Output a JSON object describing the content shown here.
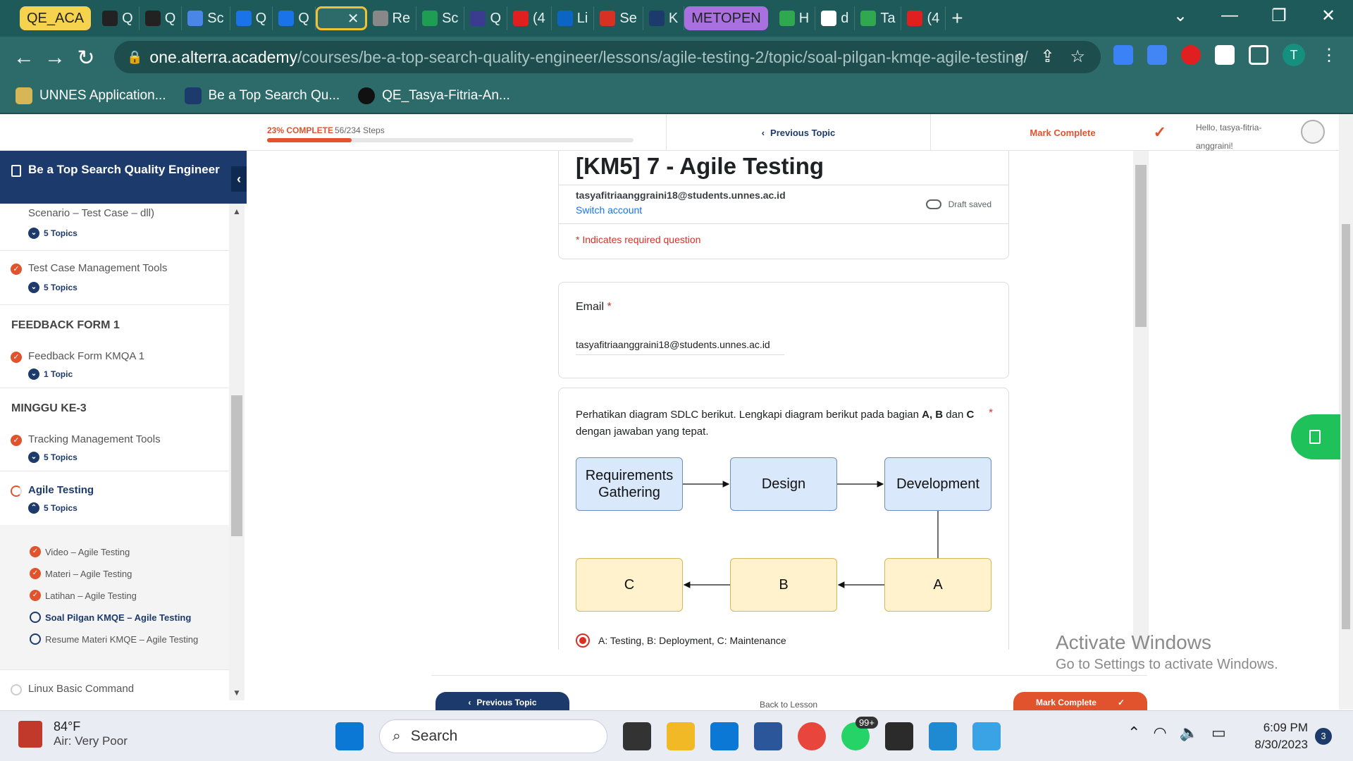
{
  "browser": {
    "tabs": [
      {
        "label": "QE_ACA",
        "color": "#f6d34c",
        "pill": true
      },
      {
        "label": "Q",
        "color": "#222222"
      },
      {
        "label": "Q",
        "color": "#222222"
      },
      {
        "label": "Sc",
        "color": "#4a86e8"
      },
      {
        "label": "Q",
        "color": "#1a73e8"
      },
      {
        "label": "Q",
        "color": "#1a73e8"
      },
      {
        "label": "",
        "color": "#2d6b6b",
        "active": true
      },
      {
        "label": "Re",
        "color": "#888888"
      },
      {
        "label": "Sc",
        "color": "#1e9e52"
      },
      {
        "label": "Q",
        "color": "#3b3b8f"
      },
      {
        "label": "(4",
        "color": "#e02020"
      },
      {
        "label": "Li",
        "color": "#0a66c2"
      },
      {
        "label": "Se",
        "color": "#d93025"
      },
      {
        "label": "K",
        "color": "#1c3a6b"
      },
      {
        "label": "METOPEN",
        "color": "#a970e0",
        "pill": true
      },
      {
        "label": "H",
        "color": "#2fa84f"
      },
      {
        "label": "d",
        "color": "#ffffff"
      },
      {
        "label": "Ta",
        "color": "#2fa84f"
      },
      {
        "label": "(4",
        "color": "#e02020"
      }
    ],
    "url_host": "one.alterra.academy",
    "url_path": "/courses/be-a-top-search-quality-engineer/lessons/agile-testing-2/topic/soal-pilgan-kmqe-agile-testing/",
    "profile_initial": "T",
    "bookmarks": [
      "UNNES Application...",
      "Be a Top Search Qu...",
      "QE_Tasya-Fitria-An..."
    ]
  },
  "topbar": {
    "progress_label": "23% COMPLETE",
    "progress_steps": "56/234 Steps",
    "progress_fraction": 0.23,
    "prev_topic": "Previous Topic",
    "mark_complete": "Mark Complete",
    "greeting": "Hello, tasya-fitria-anggraini!"
  },
  "sidebar": {
    "course_title": "Be a Top Search Quality Engineer",
    "partial_item": "Scenario – Test Case – dll)",
    "partial_topics": "5 Topics",
    "items": [
      {
        "title": "Test Case Management Tools",
        "topics": "5 Topics"
      },
      {
        "title": "Feedback Form KMQA 1",
        "topics": "1 Topic"
      },
      {
        "title": "Tracking Management Tools",
        "topics": "5 Topics"
      },
      {
        "title": "Agile Testing",
        "topics": "5 Topics"
      },
      {
        "title": "Linux Basic Command",
        "topics": ""
      }
    ],
    "sections": [
      "FEEDBACK FORM 1",
      "MINGGU KE-3"
    ],
    "subtopics": [
      {
        "title": "Video – Agile Testing",
        "done": true
      },
      {
        "title": "Materi – Agile Testing",
        "done": true
      },
      {
        "title": "Latihan – Agile Testing",
        "done": true
      },
      {
        "title": "Soal Pilgan KMQE – Agile Testing",
        "done": false,
        "current": true
      },
      {
        "title": "Resume Materi KMQE – Agile Testing",
        "done": false
      }
    ]
  },
  "form": {
    "title": "[KM5] 7 - Agile Testing",
    "account_email": "tasyafitriaanggraini18@students.unnes.ac.id",
    "switch_account": "Switch account",
    "draft_status": "Draft saved",
    "required_note": "* Indicates required question",
    "email_label": "Email",
    "email_value": "tasyafitriaanggraini18@students.unnes.ac.id",
    "question_pre": "Perhatikan diagram SDLC berikut. Lengkapi diagram berikut pada bagian ",
    "question_bold": "A, B",
    "question_mid": " dan ",
    "question_bold2": "C",
    "question_post": " dengan jawaban yang tepat.",
    "diagram": {
      "n1": "Requirements Gathering",
      "n2": "Design",
      "n3": "Development",
      "n4": "A",
      "n5": "B",
      "n6": "C"
    },
    "selected_option": "A: Testing, B: Deployment, C: Maintenance"
  },
  "bottom_nav": {
    "prev": "Previous Topic",
    "back": "Back to Lesson",
    "mark": "Mark Complete"
  },
  "watermark": {
    "line1": "Activate Windows",
    "line2": "Go to Settings to activate Windows."
  },
  "taskbar": {
    "temperature": "84°F",
    "air": "Air: Very Poor",
    "search": "Search",
    "whatsapp_badge": "99+",
    "time": "6:09 PM",
    "date": "8/30/2023",
    "notifications": "3"
  }
}
